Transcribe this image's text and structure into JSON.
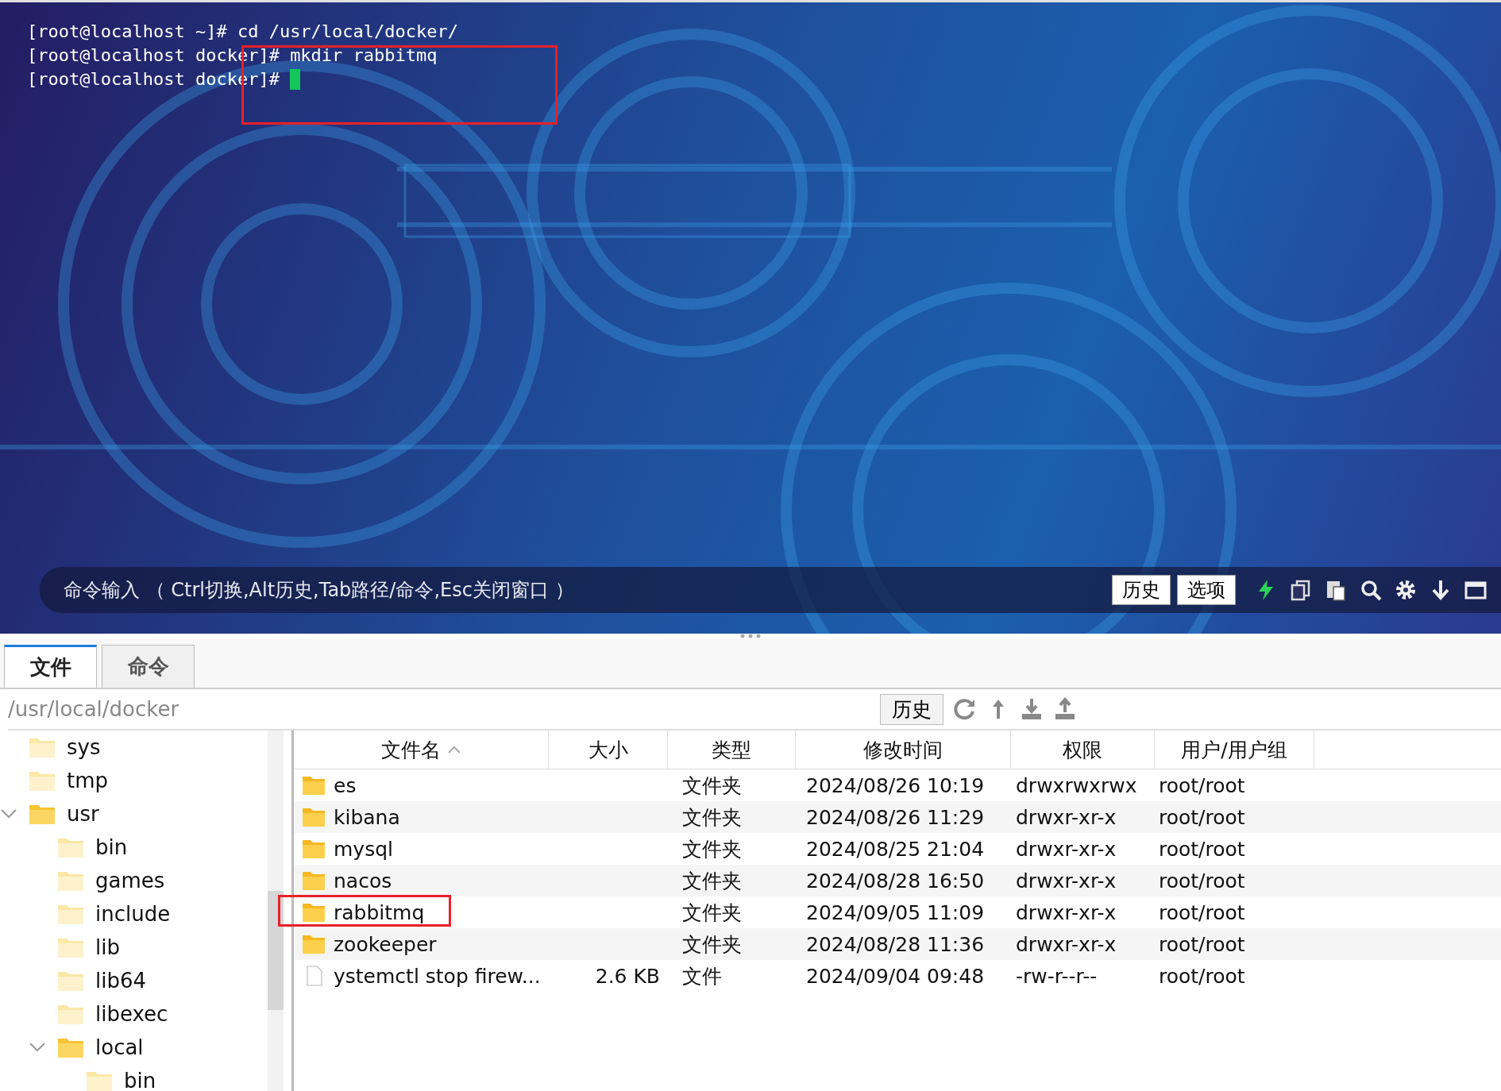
{
  "terminal": {
    "lines": [
      {
        "text": "[root@localhost ~]# cd /usr/local/docker/",
        "annotated": false
      },
      {
        "text": "[root@localhost docker]# mkdir rabbitmq",
        "annotated": true
      },
      {
        "text": "[root@localhost docker]# ",
        "annotated": true,
        "cursor": true
      }
    ]
  },
  "command_bar": {
    "placeholder": "命令输入 （ Ctrl切换,Alt历史,Tab路径/命令,Esc关闭窗口 ）",
    "buttons": [
      "历史",
      "选项"
    ]
  },
  "tabs": [
    {
      "label": "文件",
      "selected": true
    },
    {
      "label": "命令",
      "selected": false
    }
  ],
  "path_bar": {
    "path": "/usr/local/docker",
    "history_button": "历史"
  },
  "tree": [
    {
      "name": "sys",
      "expanded": false
    },
    {
      "name": "tmp",
      "expanded": false
    },
    {
      "name": "usr",
      "expanded": true,
      "children": [
        {
          "name": "bin",
          "expanded": false
        },
        {
          "name": "games",
          "expanded": false
        },
        {
          "name": "include",
          "expanded": false
        },
        {
          "name": "lib",
          "expanded": false
        },
        {
          "name": "lib64",
          "expanded": false
        },
        {
          "name": "libexec",
          "expanded": false
        },
        {
          "name": "local",
          "expanded": true,
          "children": [
            {
              "name": "bin",
              "expanded": false
            }
          ]
        }
      ]
    }
  ],
  "table": {
    "columns": [
      {
        "label": "文件名",
        "sorted": true
      },
      {
        "label": "大小",
        "sorted": false
      },
      {
        "label": "类型",
        "sorted": false
      },
      {
        "label": "修改时间",
        "sorted": false
      },
      {
        "label": "权限",
        "sorted": false
      },
      {
        "label": "用户/用户组",
        "sorted": false
      }
    ],
    "rows": [
      {
        "kind": "folder",
        "annotated": false,
        "cells": [
          "es",
          "",
          "文件夹",
          "2024/08/26 10:19",
          "drwxrwxrwx",
          "root/root"
        ]
      },
      {
        "kind": "folder",
        "annotated": false,
        "cells": [
          "kibana",
          "",
          "文件夹",
          "2024/08/26 11:29",
          "drwxr-xr-x",
          "root/root"
        ]
      },
      {
        "kind": "folder",
        "annotated": false,
        "cells": [
          "mysql",
          "",
          "文件夹",
          "2024/08/25 21:04",
          "drwxr-xr-x",
          "root/root"
        ]
      },
      {
        "kind": "folder",
        "annotated": false,
        "cells": [
          "nacos",
          "",
          "文件夹",
          "2024/08/28 16:50",
          "drwxr-xr-x",
          "root/root"
        ]
      },
      {
        "kind": "folder",
        "annotated": true,
        "cells": [
          "rabbitmq",
          "",
          "文件夹",
          "2024/09/05 11:09",
          "drwxr-xr-x",
          "root/root"
        ]
      },
      {
        "kind": "folder",
        "annotated": false,
        "cells": [
          "zookeeper",
          "",
          "文件夹",
          "2024/08/28 11:36",
          "drwxr-xr-x",
          "root/root"
        ]
      },
      {
        "kind": "file",
        "annotated": false,
        "cells": [
          "ystemctl stop firew...",
          "2.6 KB",
          "文件",
          "2024/09/04 09:48",
          "-rw-r--r--",
          "root/root"
        ]
      }
    ]
  }
}
